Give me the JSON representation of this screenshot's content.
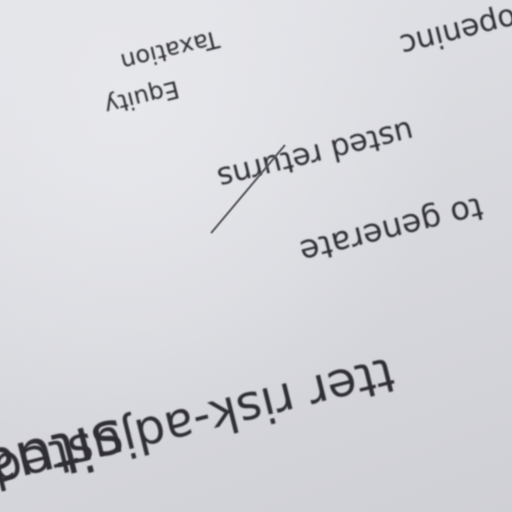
{
  "document": {
    "lines": {
      "situation": "situation",
      "risk_adjusted": "tter risk-adjusted retu",
      "generate": "to generate",
      "adjusted_returns": "usted returns",
      "equity": "Equity",
      "taxation": "Taxation",
      "opening": "openinc"
    }
  }
}
